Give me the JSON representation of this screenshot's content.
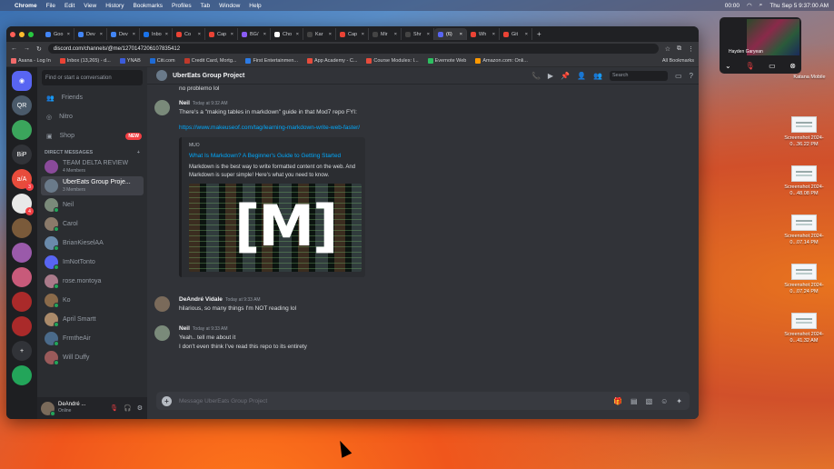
{
  "menubar": {
    "app": "Chrome",
    "items": [
      "File",
      "Edit",
      "View",
      "History",
      "Bookmarks",
      "Profiles",
      "Tab",
      "Window",
      "Help"
    ],
    "timer": "00:00",
    "datetime": "Thu Sep 5  9:37:00 AM"
  },
  "tabs": [
    {
      "label": "Goo",
      "color": "#4285f4"
    },
    {
      "label": "Dev",
      "color": "#4285f4"
    },
    {
      "label": "Dev",
      "color": "#4285f4"
    },
    {
      "label": "Inbo",
      "color": "#1a73e8"
    },
    {
      "label": "Co",
      "color": "#ea4335"
    },
    {
      "label": "Cap",
      "color": "#ea4335"
    },
    {
      "label": "BG/",
      "color": "#8a5cf6"
    },
    {
      "label": "Cho",
      "color": "#ffffff"
    },
    {
      "label": "Kar",
      "color": "#444"
    },
    {
      "label": "Cap",
      "color": "#ea4335"
    },
    {
      "label": "Mir",
      "color": "#444"
    },
    {
      "label": "Shr",
      "color": "#444"
    },
    {
      "label": "(6)",
      "color": "#5865f2",
      "active": true
    },
    {
      "label": "Wh",
      "color": "#ea4335"
    },
    {
      "label": "Git",
      "color": "#ea4335"
    }
  ],
  "address": {
    "url": "discord.com/channels/@me/1270147206107835412"
  },
  "bookmarks": [
    {
      "label": "Asana - Log In",
      "color": "#f06a6a"
    },
    {
      "label": "Inbox (13,265) - d...",
      "color": "#ea4335"
    },
    {
      "label": "YNAB",
      "color": "#3b5bdb"
    },
    {
      "label": "Citi.com",
      "color": "#1e6bd6"
    },
    {
      "label": "Credit Card, Mortg...",
      "color": "#c0392b"
    },
    {
      "label": "First Entertainmen...",
      "color": "#2c7be5"
    },
    {
      "label": "App Academy - C...",
      "color": "#e74c3c"
    },
    {
      "label": "Course Modules: I...",
      "color": "#e74c3c"
    },
    {
      "label": "Evernote Web",
      "color": "#2dbe60"
    },
    {
      "label": "Amazon.com: Onli...",
      "color": "#ff9900"
    }
  ],
  "bookmarks_all": "All Bookmarks",
  "channels": {
    "search_placeholder": "Find or start a conversation",
    "nav": [
      {
        "label": "Friends"
      },
      {
        "label": "Nitro"
      },
      {
        "label": "Shop",
        "badge": "NEW"
      }
    ],
    "dm_header": "DIRECT MESSAGES",
    "dms": [
      {
        "name": "TEAM DELTA REVIEW",
        "sub": "4 Members",
        "color": "#8a4a9a"
      },
      {
        "name": "UberEats Group Proje...",
        "sub": "3 Members",
        "color": "#6a7a8a",
        "active": true
      },
      {
        "name": "Neil",
        "color": "#7a8a7a"
      },
      {
        "name": "Carol",
        "color": "#8a7a6a"
      },
      {
        "name": "BrianKieselAA",
        "color": "#6a8aaa"
      },
      {
        "name": "ImNotTonto",
        "color": "#5865f2"
      },
      {
        "name": "rose.montoya",
        "color": "#aa7a8a"
      },
      {
        "name": "Ko",
        "color": "#8a6a4a"
      },
      {
        "name": "April Smartt",
        "color": "#aa8a6a"
      },
      {
        "name": "FrmtheAir",
        "color": "#4a6a8a"
      },
      {
        "name": "Will Duffy",
        "color": "#9a5a5a"
      }
    ]
  },
  "user": {
    "name": "DeAndré ...",
    "status": "Online"
  },
  "guilds": [
    {
      "label": "",
      "color": "#5865f2",
      "kind": "home"
    },
    {
      "label": "QR",
      "color": "#4a5a6a",
      "badge": ""
    },
    {
      "label": "",
      "color": "#3ba55c"
    },
    {
      "label": "BiP",
      "color": "#313338"
    },
    {
      "label": "a/A",
      "color": "#e74c3c",
      "badge": "3"
    },
    {
      "label": "",
      "color": "#e8e8e8",
      "badge": "4"
    },
    {
      "label": "",
      "color": "#7a5a3a"
    },
    {
      "label": "",
      "color": "#9a5aaa"
    },
    {
      "label": "",
      "color": "#c85a7a"
    },
    {
      "label": "",
      "color": "#aa2a2a"
    },
    {
      "label": "",
      "color": "#aa2a2a"
    },
    {
      "label": "+",
      "color": "#313338"
    },
    {
      "label": "",
      "color": "#23a55a"
    }
  ],
  "chat": {
    "title": "UberEats Group Project",
    "search_placeholder": "Search",
    "composer_placeholder": "Message UberEats Group Project",
    "prev_line": "no problemo lol",
    "messages": [
      {
        "author": "Neil",
        "time": "Today at 9:32 AM",
        "lines": [
          "There's a \"making tables in markdown\" guide in that Mod7 repo FYI:"
        ],
        "link": "https://www.makeuseof.com/tag/learning-markdown-write-web-faster/",
        "embed": {
          "provider": "MUO",
          "title": "What Is Markdown? A Beginner's Guide to Getting Started",
          "desc": "Markdown is the best way to write formatted content on the web. And Markdown is super simple! Here's what you need to know.",
          "image_text": "[M]"
        }
      },
      {
        "author": "DeAndré Vidale",
        "time": "Today at 9:33 AM",
        "lines": [
          "hilarious, so many things I'm NOT reading lol"
        ]
      },
      {
        "author": "Neil",
        "time": "Today at 9:33 AM",
        "lines": [
          "Yeah.. tell me about it",
          "I don't even think I've read this repo to its entirety"
        ]
      }
    ]
  },
  "desktop": [
    {
      "label": "Katana Mobile"
    },
    {
      "label": "Screenshot 2024-0...36.22 PM"
    },
    {
      "label": "Screenshot 2024-0...48.08 PM"
    },
    {
      "label": "Screenshot 2024-0...07.14 PM"
    },
    {
      "label": "Screenshot 2024-0...07.24 PM"
    },
    {
      "label": "Screenshot 2024-0...41.32 AM"
    }
  ],
  "facetime": {
    "name": "Hayden Garyean"
  }
}
